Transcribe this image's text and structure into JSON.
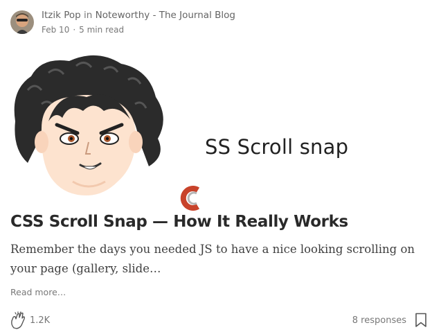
{
  "post": {
    "author": "Itzik Pop",
    "connector": "in",
    "publication": "Noteworthy - The Journal Blog",
    "date": "Feb 10",
    "separator": "·",
    "read_time": "5 min read",
    "hero_text": "SS Scroll snap",
    "title": "CSS Scroll Snap — How It Really Works",
    "subtitle": "Remember the days you needed JS to have a nice looking scrolling on your page (gallery, slide…",
    "read_more": "Read more…",
    "claps": "1.2K",
    "responses": "8 responses"
  },
  "icons": {
    "avatar": "author-avatar",
    "clap": "clap-icon",
    "bookmark": "bookmark-icon",
    "logo": "css-logo-c"
  },
  "colors": {
    "text_primary": "#222222",
    "text_muted": "#7a7a7a",
    "logo_red": "#c8432b",
    "logo_gray": "#b5b5b5",
    "face_skin": "#fde3cf"
  }
}
